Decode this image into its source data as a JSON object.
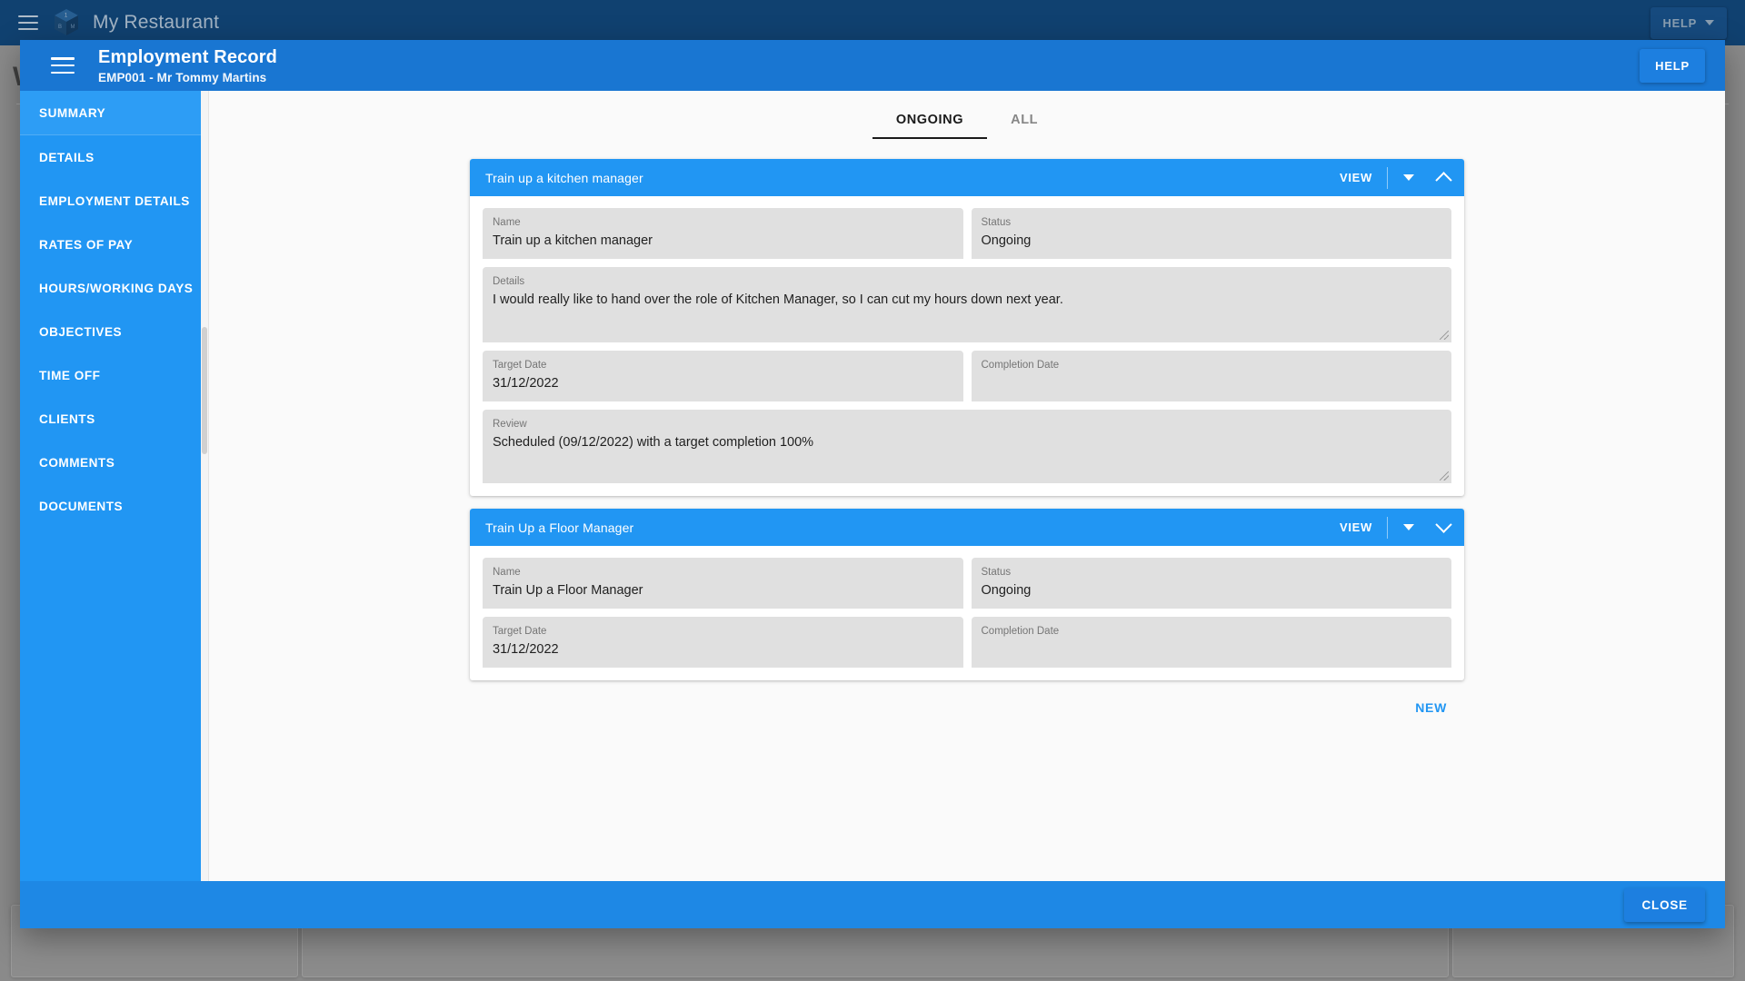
{
  "app": {
    "title": "My Restaurant",
    "menu_icon": "hamburger-icon",
    "logo_icon": "cube-logo-icon",
    "logo_faces": {
      "top": "1",
      "left": "B",
      "right": "M"
    },
    "help_label": "HELP",
    "help_caret_icon": "caret-down-icon",
    "background_letter": "W"
  },
  "modal": {
    "menu_icon": "hamburger-icon",
    "title": "Employment Record",
    "subtitle": "EMP001 - Mr Tommy Martins",
    "help_label": "HELP",
    "close_label": "CLOSE"
  },
  "sidebar": {
    "items": [
      {
        "label": "SUMMARY",
        "active": true
      },
      {
        "label": "DETAILS",
        "active": false
      },
      {
        "label": "EMPLOYMENT DETAILS",
        "active": false
      },
      {
        "label": "RATES OF PAY",
        "active": false
      },
      {
        "label": "HOURS/WORKING DAYS",
        "active": false
      },
      {
        "label": "OBJECTIVES",
        "active": false
      },
      {
        "label": "TIME OFF",
        "active": false
      },
      {
        "label": "CLIENTS",
        "active": false
      },
      {
        "label": "COMMENTS",
        "active": false
      },
      {
        "label": "DOCUMENTS",
        "active": false
      }
    ]
  },
  "tabs": [
    {
      "label": "ONGOING",
      "active": true
    },
    {
      "label": "ALL",
      "active": false
    }
  ],
  "labels": {
    "name": "Name",
    "status": "Status",
    "details": "Details",
    "target_date": "Target Date",
    "completion_date": "Completion Date",
    "review": "Review",
    "view": "VIEW",
    "new": "NEW"
  },
  "objectives": [
    {
      "header_title": "Train up a kitchen manager",
      "expanded": true,
      "menu_icon": "triangle-down-icon",
      "toggle_icon": "chevron-up-icon",
      "name": "Train up a kitchen manager",
      "status": "Ongoing",
      "details": "I would really like to hand over the role of Kitchen Manager, so I can cut my hours down next year.",
      "target_date": "31/12/2022",
      "completion_date": "",
      "review": "Scheduled (09/12/2022) with a target completion 100%"
    },
    {
      "header_title": "Train Up a Floor Manager",
      "expanded": false,
      "menu_icon": "triangle-down-icon",
      "toggle_icon": "chevron-down-icon",
      "name": "Train Up a Floor Manager",
      "status": "Ongoing",
      "target_date": "31/12/2022",
      "completion_date": ""
    }
  ],
  "colors": {
    "topbar": "#134a80",
    "modal_header": "#1976d2",
    "sidebar": "#2196f3",
    "card_header": "#2196f3",
    "accent": "#2196f3",
    "footer": "#1e88e5",
    "field_bg": "#e0e0e0"
  }
}
